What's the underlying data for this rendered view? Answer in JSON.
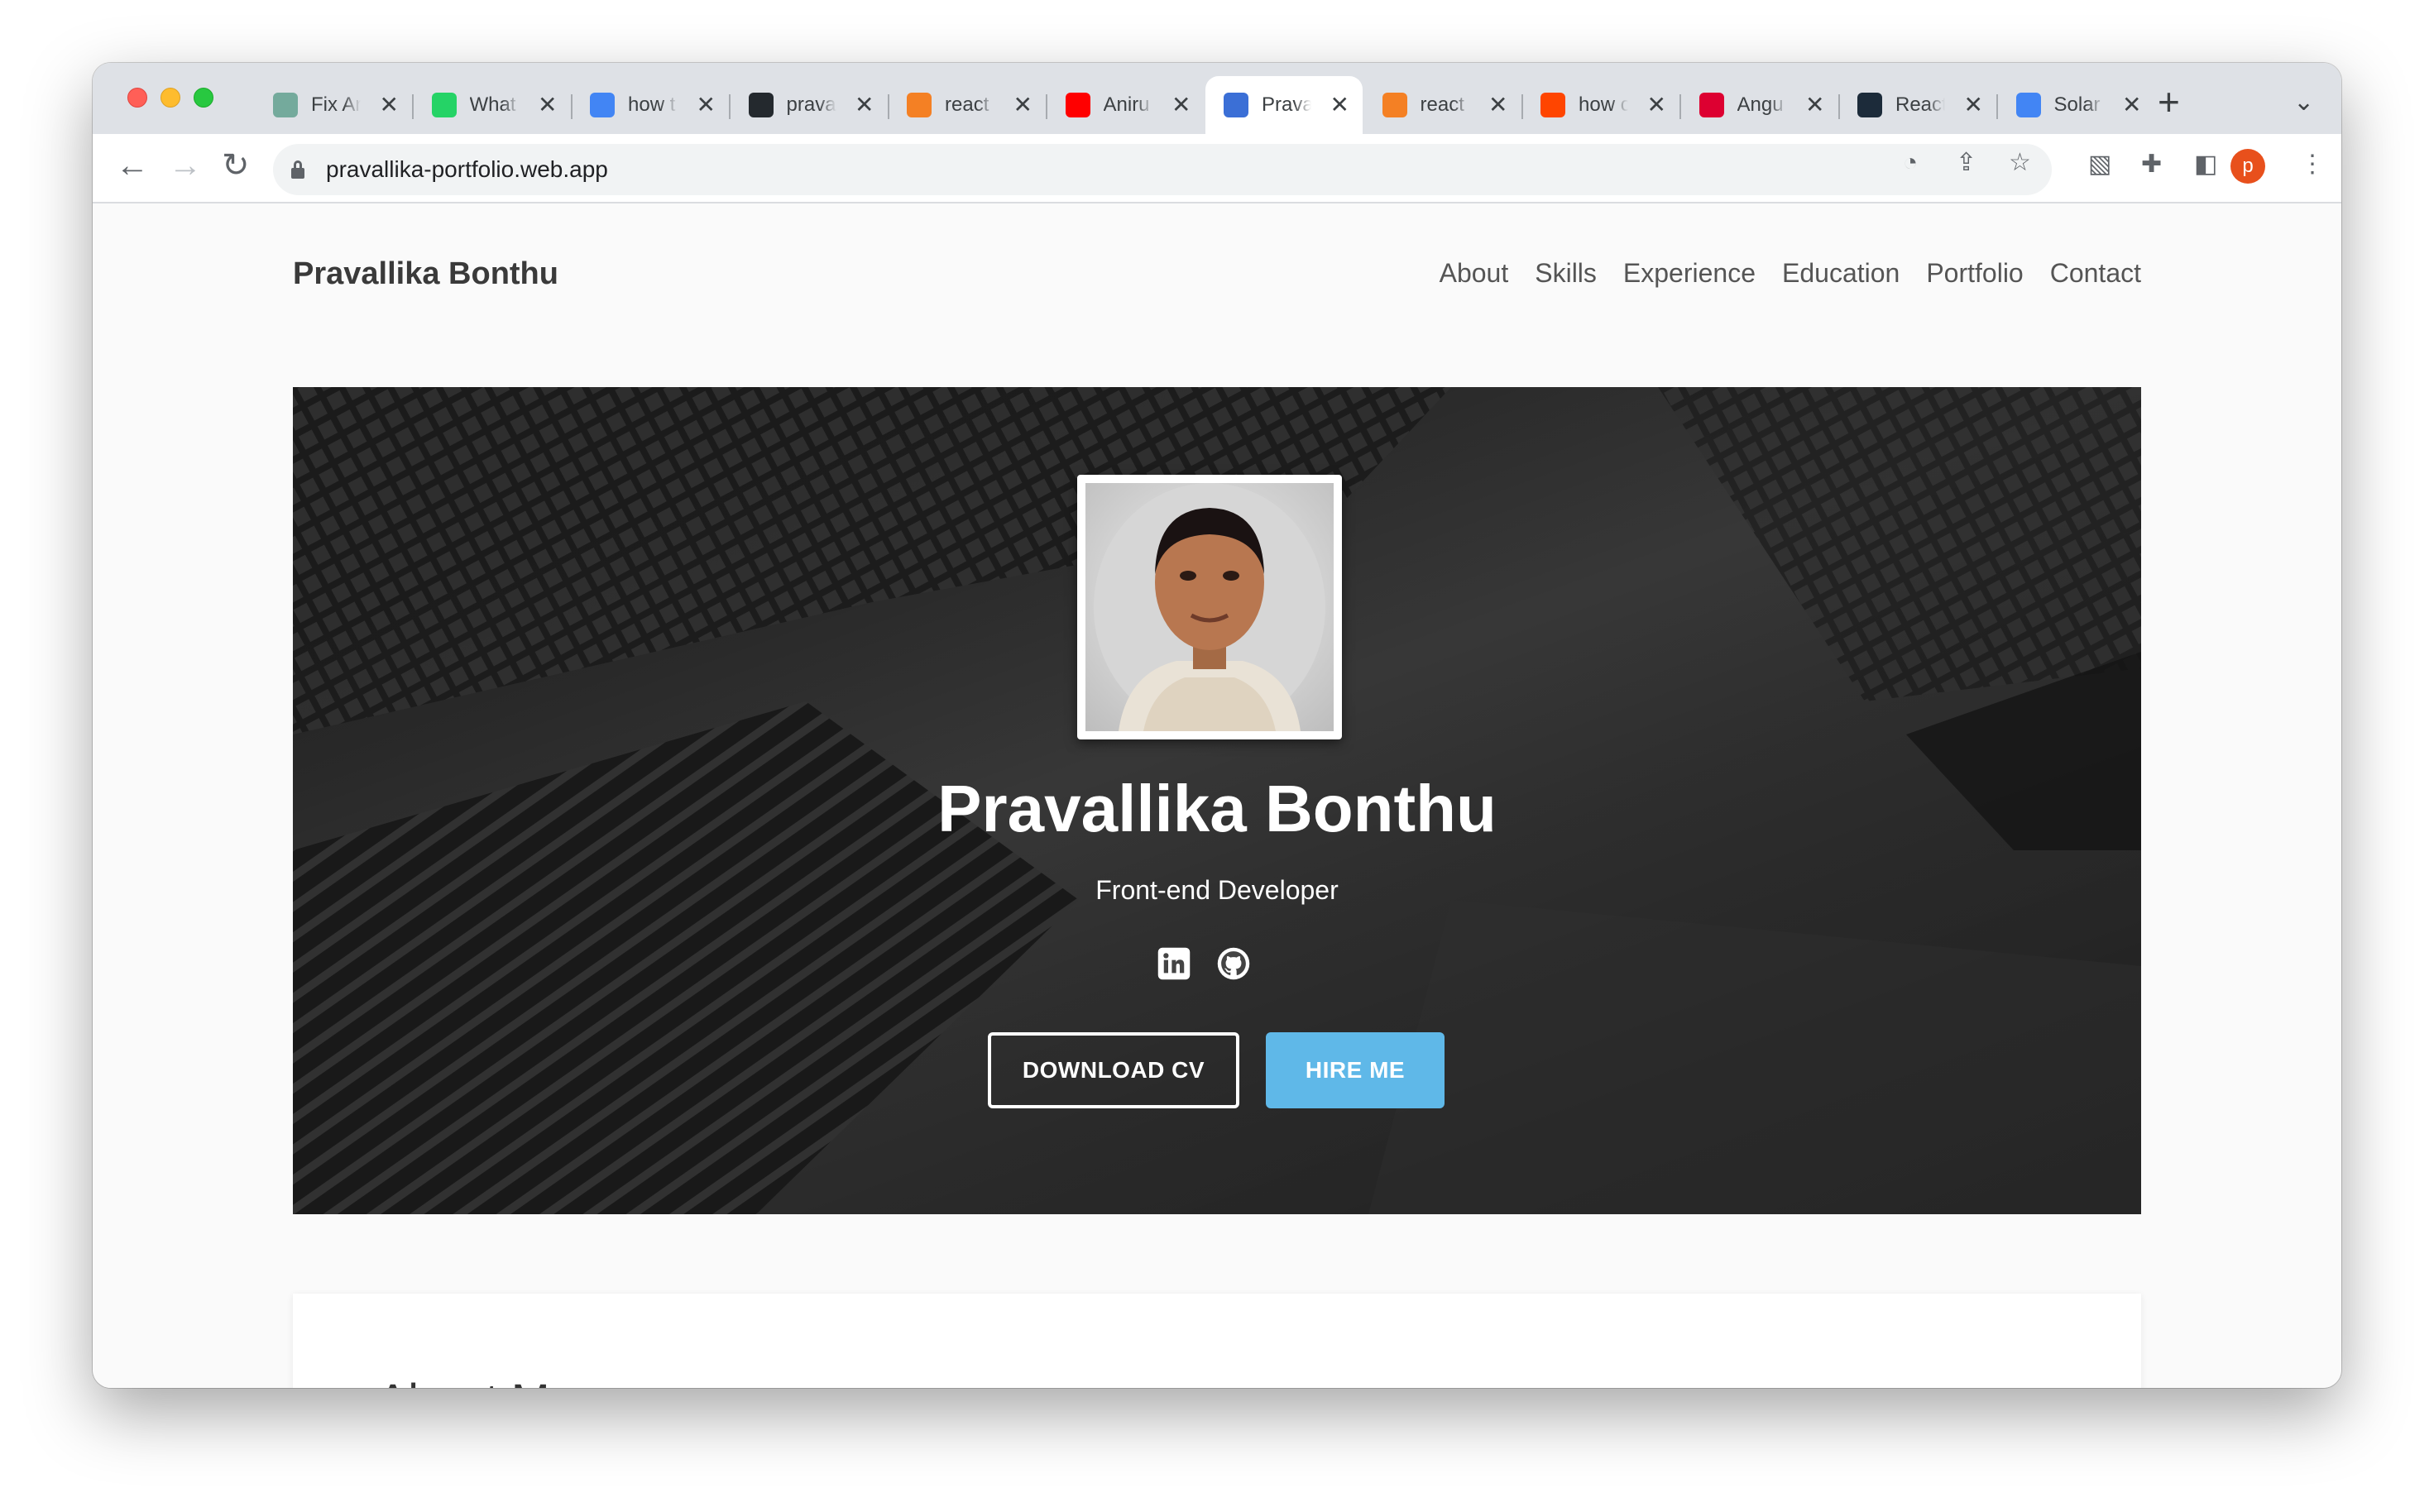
{
  "browser": {
    "tabs": [
      {
        "title": "Fix Ar",
        "icon": "chatgpt-icon",
        "color": "#74aa9c"
      },
      {
        "title": "What",
        "icon": "whatsapp-icon",
        "color": "#25d366"
      },
      {
        "title": "how t",
        "icon": "google-icon",
        "color": "#4285f4"
      },
      {
        "title": "prava",
        "icon": "github-icon",
        "color": "#24292e"
      },
      {
        "title": "react",
        "icon": "stackoverflow-icon",
        "color": "#f48024"
      },
      {
        "title": "Aniru",
        "icon": "youtube-icon",
        "color": "#ff0000"
      },
      {
        "title": "Prava",
        "icon": "portfolio-icon",
        "color": "#3b6fd6",
        "active": true
      },
      {
        "title": "react",
        "icon": "stackoverflow-icon",
        "color": "#f48024"
      },
      {
        "title": "how c",
        "icon": "reddit-icon",
        "color": "#ff4500"
      },
      {
        "title": "Angu",
        "icon": "angular-icon",
        "color": "#dd0031"
      },
      {
        "title": "React",
        "icon": "react-icon",
        "color": "#1c2b3a"
      },
      {
        "title": "Solar",
        "icon": "docs-icon",
        "color": "#4285f4"
      }
    ],
    "close_glyph": "✕",
    "new_tab_glyph": "+",
    "url": "pravallika-portfolio.web.app",
    "profile_initial": "p",
    "profile_color": "#e8501c"
  },
  "site": {
    "brand": "Pravallika Bonthu",
    "nav": [
      "About",
      "Skills",
      "Experience",
      "Education",
      "Portfolio",
      "Contact"
    ],
    "hero": {
      "name": "Pravallika Bonthu",
      "role": "Front-end Developer",
      "download_cv": "DOWNLOAD CV",
      "hire_me": "HIRE ME",
      "hire_color": "#5fb8e8"
    },
    "about_title": "About Me"
  }
}
